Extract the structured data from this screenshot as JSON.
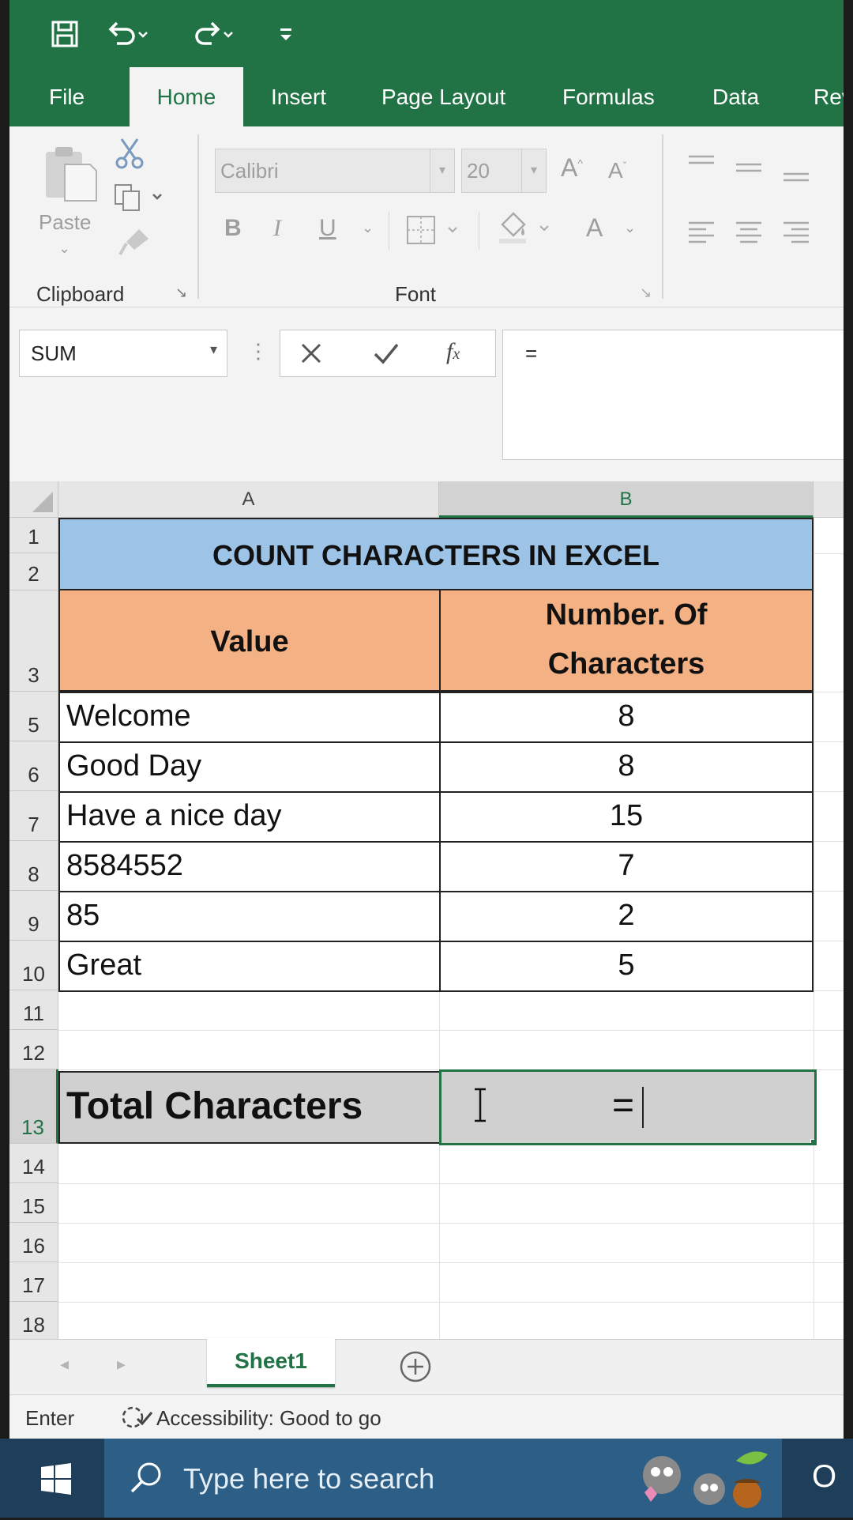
{
  "ribbon_tabs": [
    "File",
    "Home",
    "Insert",
    "Page Layout",
    "Formulas",
    "Data",
    "Rev"
  ],
  "active_tab": "Home",
  "clipboard": {
    "paste_label": "Paste",
    "group_label": "Clipboard"
  },
  "font": {
    "family": "Calibri",
    "size": "20",
    "group_label": "Font"
  },
  "formula_bar": {
    "name_box": "SUM",
    "formula": "="
  },
  "columns": [
    "A",
    "B"
  ],
  "sheet": {
    "title": "COUNT CHARACTERS IN EXCEL",
    "header_value": "Value",
    "header_count_line1": "Number. Of",
    "header_count_line2": "Characters",
    "rows": [
      {
        "row": "5",
        "value": "Welcome",
        "count": "8"
      },
      {
        "row": "6",
        "value": "Good Day",
        "count": "8"
      },
      {
        "row": "7",
        "value": "Have a nice day",
        "count": "15"
      },
      {
        "row": "8",
        "value": "8584552",
        "count": "7"
      },
      {
        "row": "9",
        "value": "85",
        "count": "2"
      },
      {
        "row": "10",
        "value": "Great",
        "count": "5"
      }
    ],
    "total_label": "Total Characters",
    "active_value": "="
  },
  "row_numbers": [
    "1",
    "2",
    "3",
    "5",
    "6",
    "7",
    "8",
    "9",
    "10",
    "11",
    "12",
    "13",
    "14",
    "15",
    "16",
    "17",
    "18"
  ],
  "sheet_tab": "Sheet1",
  "status": {
    "mode": "Enter",
    "accessibility": "Accessibility: Good to go"
  },
  "taskbar": {
    "search_placeholder": "Type here to search"
  },
  "colors": {
    "excel_green": "#217346",
    "title_fill": "#9dc3e6",
    "header_fill": "#f4b183",
    "taskbar": "#1f3e5a"
  }
}
